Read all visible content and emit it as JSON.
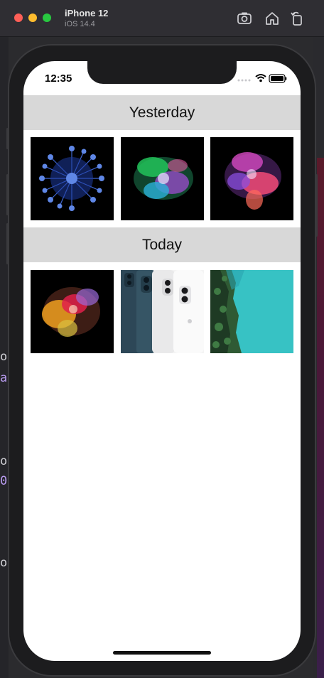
{
  "simulator": {
    "device_name": "iPhone 12",
    "os_version": "iOS 14.4",
    "toolbar_icons": [
      "screenshot-icon",
      "home-icon",
      "rotate-icon"
    ]
  },
  "status_bar": {
    "time": "12:35",
    "icons": [
      "cellular-icon",
      "wifi-icon",
      "battery-icon"
    ]
  },
  "sections": [
    {
      "title": "Yesterday",
      "photos": [
        {
          "name": "blue-sphere-photo",
          "colors": [
            "#1d3a9e",
            "#5f87e6"
          ]
        },
        {
          "name": "green-powder-burst-photo",
          "colors": [
            "#22c35a",
            "#a84ddb"
          ]
        },
        {
          "name": "pink-powder-burst-photo",
          "colors": [
            "#ff4f7a",
            "#8a4de0"
          ]
        }
      ]
    },
    {
      "title": "Today",
      "photos": [
        {
          "name": "orange-powder-burst-photo",
          "colors": [
            "#f0a020",
            "#e0204a"
          ]
        },
        {
          "name": "iphone-12-phones-photo",
          "colors": [
            "#2d4757",
            "#f2f2f2"
          ]
        },
        {
          "name": "forest-coast-aerial-photo",
          "colors": [
            "#37c2c4",
            "#1e3a24"
          ]
        }
      ]
    }
  ],
  "backdrop_fragments": [
    "ou",
    "a",
    "ou",
    "0",
    "ou"
  ]
}
